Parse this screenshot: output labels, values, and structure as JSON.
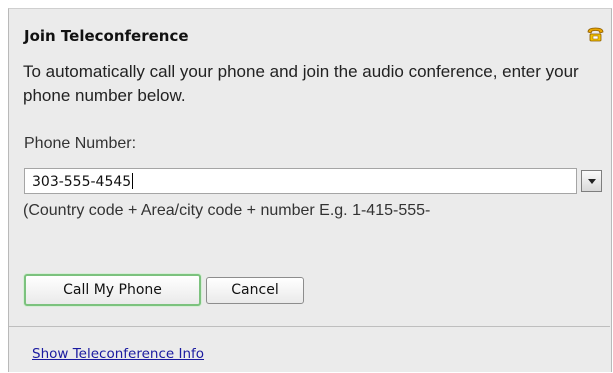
{
  "dialog": {
    "title": "Join Teleconference",
    "icon": "phone-icon",
    "description": "To automatically call your phone and join the audio conference, enter your phone number below.",
    "phone_label": "Phone Number:",
    "phone_value": "303-555-4545",
    "hint": "(Country code + Area/city code + number E.g. 1-415-555-",
    "buttons": {
      "call": "Call My Phone",
      "cancel": "Cancel"
    },
    "footer_link": "Show Teleconference Info"
  },
  "colors": {
    "background": "#ebebeb",
    "call_button_border": "#7cc27e",
    "link": "#1a1aa0",
    "icon_orange": "#e8a500"
  }
}
